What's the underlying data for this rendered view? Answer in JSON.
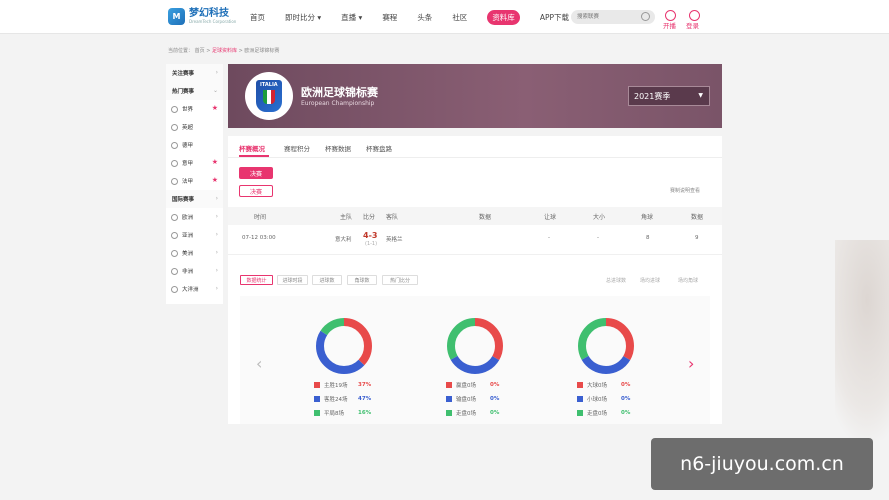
{
  "header": {
    "logo_title": "梦幻科技",
    "logo_sub": "DreamTech Corporation",
    "nav": [
      "首页",
      "即时比分",
      "直播",
      "赛程",
      "头条",
      "社区",
      "资料库",
      "APP下载"
    ],
    "nav_active_index": 6,
    "search_placeholder": "搜索联赛",
    "actions": {
      "open": "开播",
      "login": "登录"
    }
  },
  "breadcrumb": {
    "prefix": "当前位置：",
    "home": "首页",
    "db": "足球资料库",
    "current": "欧洲足球锦标赛"
  },
  "sidebar": {
    "rows": [
      {
        "label": "关注赛事",
        "type": "group"
      },
      {
        "label": "热门赛事",
        "type": "group"
      },
      {
        "label": "世界",
        "type": "item",
        "star": true
      },
      {
        "label": "英超",
        "type": "item"
      },
      {
        "label": "德甲",
        "type": "item"
      },
      {
        "label": "意甲",
        "type": "item",
        "star": true
      },
      {
        "label": "法甲",
        "type": "item",
        "star": true
      },
      {
        "label": "国际赛事",
        "type": "group"
      },
      {
        "label": "欧洲",
        "type": "item"
      },
      {
        "label": "亚洲",
        "type": "item"
      },
      {
        "label": "美洲",
        "type": "item"
      },
      {
        "label": "非洲",
        "type": "item"
      },
      {
        "label": "大洋洲",
        "type": "item"
      }
    ]
  },
  "banner": {
    "crest_text": "ITALIA",
    "title": "欧洲足球锦标赛",
    "subtitle": "European Championship",
    "season": "2021赛季"
  },
  "tabs": [
    "杯赛概况",
    "赛程积分",
    "杯赛数据",
    "杯赛盘路"
  ],
  "stages": [
    "决赛",
    "决赛"
  ],
  "link_right": "赛制说明查看",
  "table": {
    "headers": [
      "时间",
      "主队",
      "比分",
      "客队",
      "数据",
      "让球",
      "大小",
      "角球",
      "数据"
    ],
    "row": {
      "time": "07-12 03:00",
      "home": "意大利",
      "score": "4-3",
      "half": "(1-1)",
      "away": "英格兰",
      "handicap": "-",
      "ou": "-",
      "corner": "8",
      "data": "9"
    }
  },
  "stat_tabs": [
    "数据统计",
    "进球时段",
    "进球数",
    "角球数",
    "热门比分"
  ],
  "stat_right": [
    "总进球数",
    "场均进球",
    "场均角球"
  ],
  "charts": [
    {
      "legend": [
        {
          "name": "主胜19场",
          "pct": "37%",
          "color": "#e84a4a"
        },
        {
          "name": "客胜24场",
          "pct": "47%",
          "color": "#3a5fd0"
        },
        {
          "name": "平局8场",
          "pct": "16%",
          "color": "#3fbf6f"
        }
      ]
    },
    {
      "legend": [
        {
          "name": "赢盘0场",
          "pct": "0%",
          "color": "#e84a4a"
        },
        {
          "name": "输盘0场",
          "pct": "0%",
          "color": "#3a5fd0"
        },
        {
          "name": "走盘0场",
          "pct": "0%",
          "color": "#3fbf6f"
        }
      ]
    },
    {
      "legend": [
        {
          "name": "大球0场",
          "pct": "0%",
          "color": "#e84a4a"
        },
        {
          "name": "小球0场",
          "pct": "0%",
          "color": "#3a5fd0"
        },
        {
          "name": "走盘0场",
          "pct": "0%",
          "color": "#3fbf6f"
        }
      ]
    }
  ],
  "watermark": "n6-jiuyou.com.cn"
}
